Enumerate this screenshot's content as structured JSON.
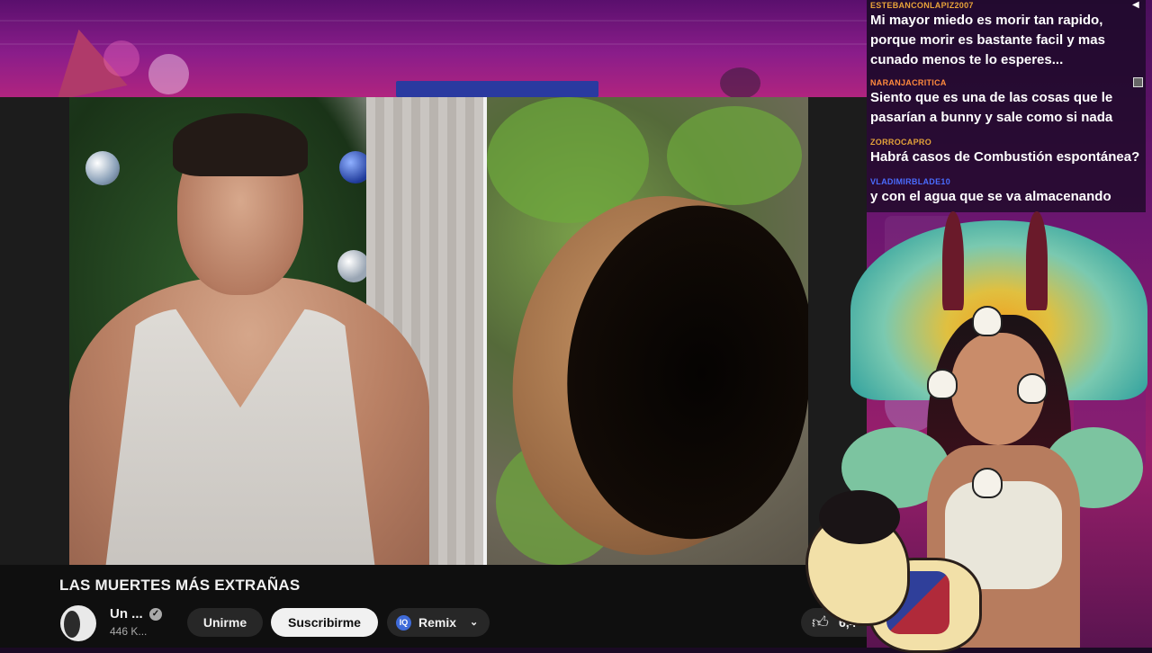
{
  "video": {
    "title": "LAS MUERTES MÁS EXTRAÑAS",
    "channel_name": "Un ...",
    "subscribers": "446 K...",
    "join_label": "Unirme",
    "subscribe_label": "Suscribirme",
    "remix_label": "Remix",
    "remix_icon": "IQ",
    "like_count": "6,4",
    "verified_glyph": "✓"
  },
  "chat": {
    "messages": [
      {
        "user": "ESTEBANCONLAPIZ2007",
        "user_color": "#e8a33a",
        "lines": [
          "Mi mayor miedo es morir tan rapido,",
          "porque morir es bastante facil y mas",
          "cunado menos te lo esperes..."
        ]
      },
      {
        "user": "NARANJACRITICA",
        "user_color": "#ff8a3d",
        "lines": [
          "Siento que es una de las cosas que le",
          "pasarían a bunny y sale como si nada"
        ]
      },
      {
        "user": "ZORROCAPRO",
        "user_color": "#e3a23a",
        "lines": [
          "Habrá casos de Combustión espontánea?"
        ]
      },
      {
        "user": "VLADIMIRBLADE10",
        "user_color": "#4a6cff",
        "lines": [
          "y con el agua que se va almacenando"
        ]
      }
    ]
  },
  "colors": {
    "accent_subscribe": "#f1f1f1",
    "button_dark": "#272727",
    "background_overlay": "#8a1d8a"
  },
  "icons": [
    "verified-badge-icon",
    "remix-icon",
    "chevron-down-icon",
    "thumbs-up-icon",
    "speaker-icon"
  ]
}
